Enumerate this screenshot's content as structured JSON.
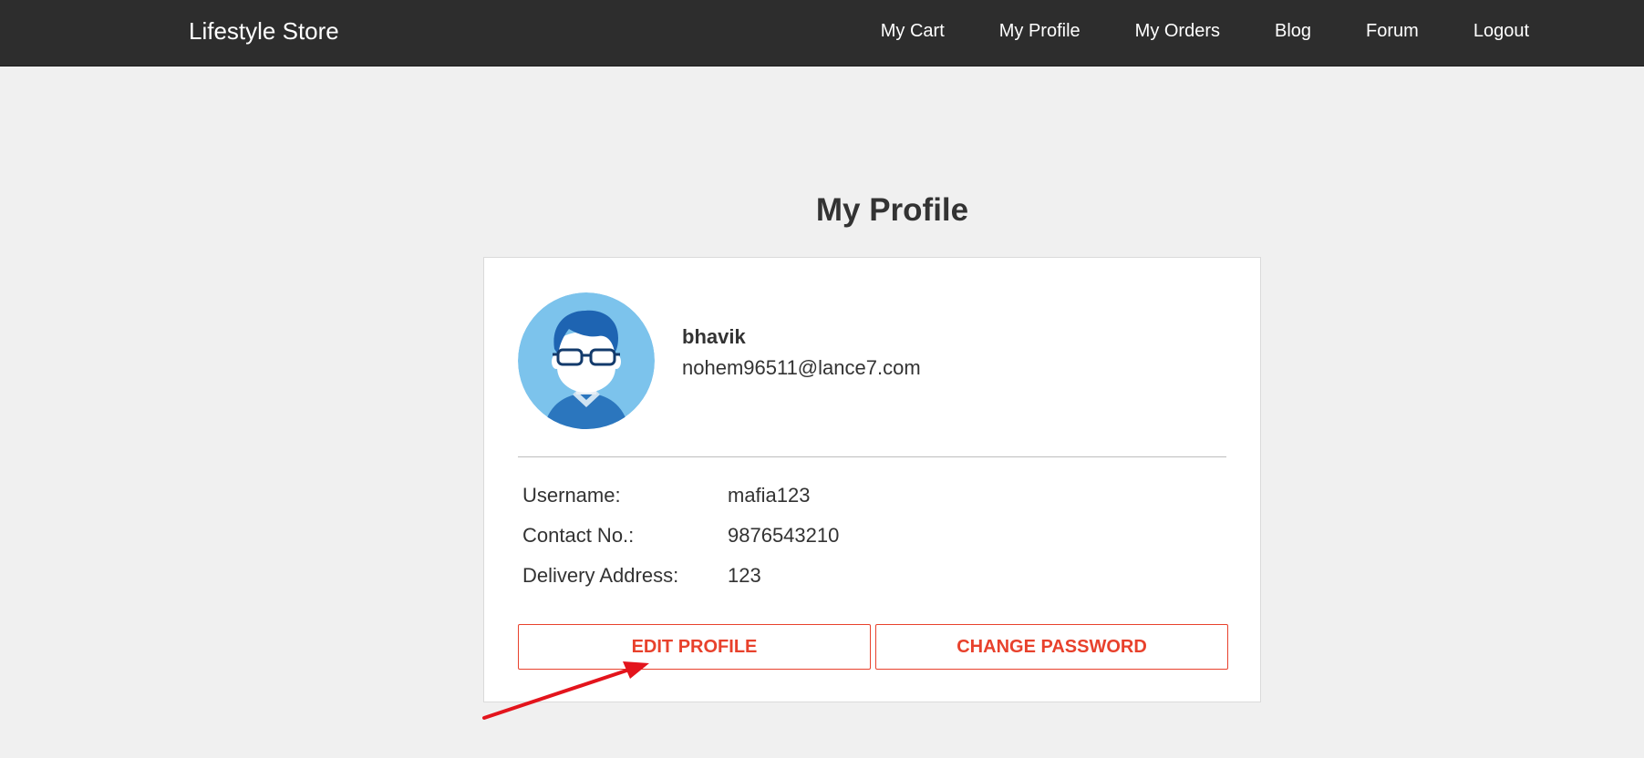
{
  "navbar": {
    "brand": "Lifestyle Store",
    "links": [
      {
        "label": "My Cart"
      },
      {
        "label": "My Profile"
      },
      {
        "label": "My Orders"
      },
      {
        "label": "Blog"
      },
      {
        "label": "Forum"
      },
      {
        "label": "Logout"
      }
    ]
  },
  "page": {
    "title": "My Profile"
  },
  "profile": {
    "name": "bhavik",
    "email": "nohem96511@lance7.com",
    "details": [
      {
        "label": "Username:",
        "value": "mafia123"
      },
      {
        "label": "Contact No.:",
        "value": "9876543210"
      },
      {
        "label": "Delivery Address:",
        "value": "123"
      }
    ]
  },
  "actions": {
    "edit_label": "EDIT PROFILE",
    "change_password_label": "CHANGE PASSWORD"
  },
  "colors": {
    "navbar_bg": "#2d2d2d",
    "page_bg": "#f0f0f0",
    "accent": "#e8412c",
    "annotation_arrow": "#e3141c"
  },
  "icons": {
    "avatar": "user-avatar-icon",
    "annotation": "arrow-annotation-icon"
  }
}
